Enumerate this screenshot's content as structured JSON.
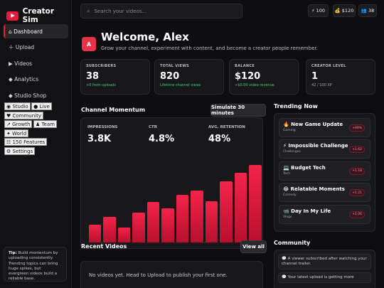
{
  "app": {
    "name": "Creator Sim"
  },
  "sidebar": {
    "items": [
      {
        "label": "⌂ Dashboard"
      },
      {
        "label": "＋ Upload"
      },
      {
        "label": "▶ Videos"
      },
      {
        "label": "◆ Analytics"
      },
      {
        "label": "◆ Studio Shop"
      }
    ],
    "chips": [
      "◉ Studio",
      "● Live",
      "♥ Community",
      "↗ Growth",
      "♟ Team",
      "✦ World",
      "☷ 150 Features",
      "⚙ Settings"
    ],
    "tip": {
      "bold": "Tip:",
      "text": " Build momentum by uploading consistently. Trending topics can bring huge spikes, but evergreen videos build a reliable base."
    }
  },
  "topbar": {
    "search_placeholder": "Search your videos...",
    "energy": "⚡ 100",
    "money": "💰 $120",
    "followers": "👥 38"
  },
  "welcome": {
    "avatar": "A",
    "title": "Welcome, Alex",
    "subtitle": "Grow your channel, experiment with content, and become a creator people remember."
  },
  "stats": [
    {
      "label": "SUBSCRIBERS",
      "value": "38",
      "sub": "+0 from uploads"
    },
    {
      "label": "TOTAL VIEWS",
      "value": "820",
      "sub": "Lifetime channel views"
    },
    {
      "label": "BALANCE",
      "value": "$120",
      "sub": "+$0.00 video revenue"
    },
    {
      "label": "CREATOR LEVEL",
      "value": "1",
      "sub": "42 / 100 XP"
    }
  ],
  "momentum": {
    "title": "Channel Momentum",
    "button": "Simulate 30 minutes",
    "metrics": [
      {
        "label": "IMPRESSIONS",
        "value": "3.8K"
      },
      {
        "label": "CTR",
        "value": "4.8%"
      },
      {
        "label": "AVG. RETENTION",
        "value": "48%"
      }
    ]
  },
  "chart_data": {
    "type": "bar",
    "values": [
      17,
      24,
      14,
      28,
      38,
      32,
      45,
      49,
      39,
      58,
      66,
      73
    ],
    "ylim": [
      0,
      80
    ]
  },
  "trending": {
    "title": "Trending Now",
    "items": [
      {
        "title": "🔥 New Game Update",
        "category": "Gaming",
        "badge": "+99%"
      },
      {
        "title": "⚡ Impossible Challenge",
        "category": "Challenges",
        "badge": "+1.62"
      },
      {
        "title": "💻 Budget Tech",
        "category": "Tech",
        "badge": "+1.18"
      },
      {
        "title": "😂 Relatable Moments",
        "category": "Comedy",
        "badge": "+1.21"
      },
      {
        "title": "📹 Day In My Life",
        "category": "Vlogs",
        "badge": "+1.06"
      }
    ]
  },
  "recent": {
    "title": "Recent Videos",
    "button": "View all",
    "empty": "No videos yet. Head to Upload to publish your first one."
  },
  "community": {
    "title": "Community",
    "items": [
      "💬 A viewer subscribed after watching your channel trailer.",
      "💬 Your latest upload is getting more"
    ]
  },
  "colors": {
    "accent": "#e8193a",
    "positive": "#3ecf7a",
    "background": "#0e0e10"
  }
}
